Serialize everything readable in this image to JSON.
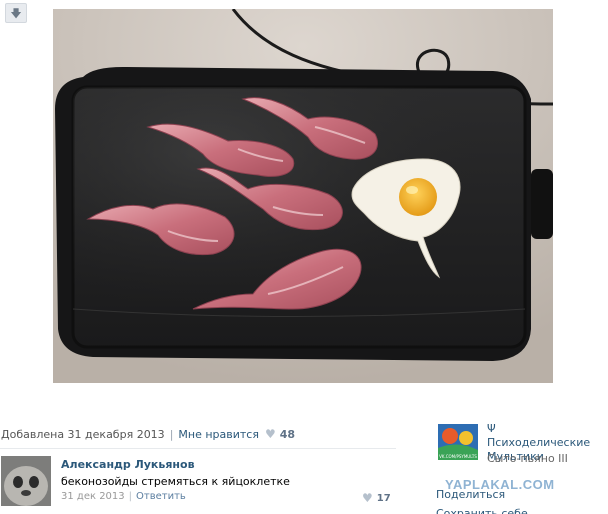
{
  "post": {
    "added_date": "Добавлена 31 декабря 2013",
    "like_label": "Мне нравится",
    "like_count": "48"
  },
  "comment": {
    "author": "Александр Лукьянов",
    "text": "беконозойды стремяться к яйцоклетке",
    "date": "31 дек 2013",
    "reply_label": "Ответить",
    "like_count": "17"
  },
  "sidebar": {
    "group_title": "Ψ Психоделические Мультики",
    "group_subtitle": "Сыто-пьяно III",
    "thumb_caption": "VK.COM/PSYMULTS",
    "share_label": "Поделиться",
    "save_label": "Сохранить себе"
  },
  "watermark": "YAPLAKAL.COM",
  "icons": {
    "download": "download-arrow-icon",
    "heart": "heart-icon"
  },
  "colors": {
    "link": "#2b587a",
    "muted": "#999999",
    "watermark": "#8fb3d3"
  }
}
